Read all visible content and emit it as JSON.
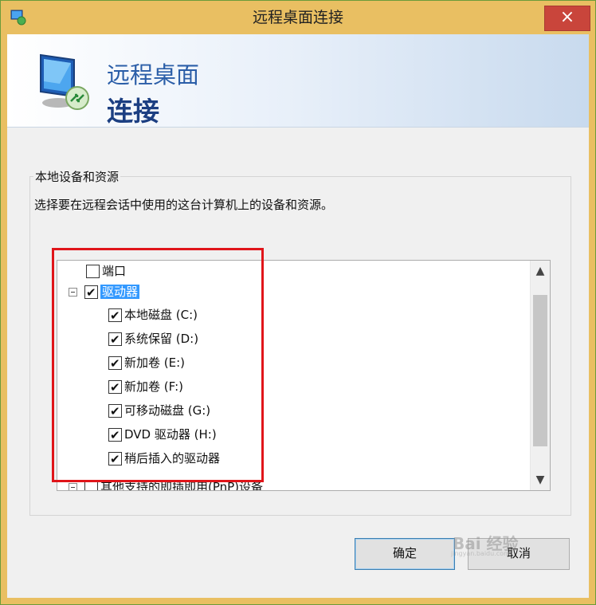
{
  "window": {
    "title": "远程桌面连接",
    "close_label": "×"
  },
  "banner": {
    "line1": "远程桌面",
    "line2": "连接"
  },
  "group": {
    "title": "本地设备和资源",
    "description": "选择要在远程会话中使用的这台计算机上的设备和资源。"
  },
  "tree": {
    "ports": {
      "label": "端口",
      "checked": false
    },
    "drives": {
      "label": "驱动器",
      "checked": true,
      "expanded": true,
      "children": [
        {
          "label": "本地磁盘 (C:)",
          "checked": true
        },
        {
          "label": "系统保留 (D:)",
          "checked": true
        },
        {
          "label": "新加卷 (E:)",
          "checked": true
        },
        {
          "label": "新加卷 (F:)",
          "checked": true
        },
        {
          "label": "可移动磁盘 (G:)",
          "checked": true
        },
        {
          "label": "DVD 驱动器 (H:)",
          "checked": true
        },
        {
          "label": "稍后插入的驱动器",
          "checked": true
        }
      ]
    },
    "other_devices": {
      "label": "其他支持的即插即用(PnP)设备",
      "checked": false
    }
  },
  "buttons": {
    "ok": "确定",
    "cancel": "取消"
  },
  "watermark": {
    "text": "Bai 经验",
    "sub": "jingyan.baidu.com"
  },
  "colors": {
    "titlebar": "#e9bf62",
    "close": "#c9453b",
    "highlight": "#e0151a",
    "selection": "#3399ff"
  }
}
